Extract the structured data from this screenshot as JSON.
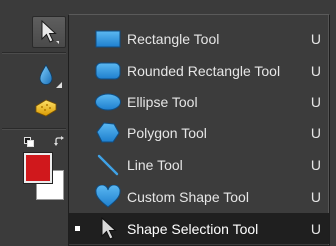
{
  "toolbar": {
    "active_tool": "arrow-select-icon",
    "foreground_color": "#d0181c",
    "background_color": "#ffffff"
  },
  "flyout": {
    "accent_color": "#2e8fd9",
    "selected_background": "#1f1f1f",
    "items": [
      {
        "label": "Rectangle Tool",
        "shortcut": "U",
        "icon": "rectangle-shape-icon",
        "selected": false
      },
      {
        "label": "Rounded Rectangle Tool",
        "shortcut": "U",
        "icon": "rounded-rectangle-shape-icon",
        "selected": false
      },
      {
        "label": "Ellipse Tool",
        "shortcut": "U",
        "icon": "ellipse-shape-icon",
        "selected": false
      },
      {
        "label": "Polygon Tool",
        "shortcut": "U",
        "icon": "polygon-shape-icon",
        "selected": false
      },
      {
        "label": "Line Tool",
        "shortcut": "U",
        "icon": "line-shape-icon",
        "selected": false
      },
      {
        "label": "Custom Shape Tool",
        "shortcut": "U",
        "icon": "heart-shape-icon",
        "selected": false
      },
      {
        "label": "Shape Selection Tool",
        "shortcut": "U",
        "icon": "arrow-pointer-icon",
        "selected": true
      }
    ]
  }
}
